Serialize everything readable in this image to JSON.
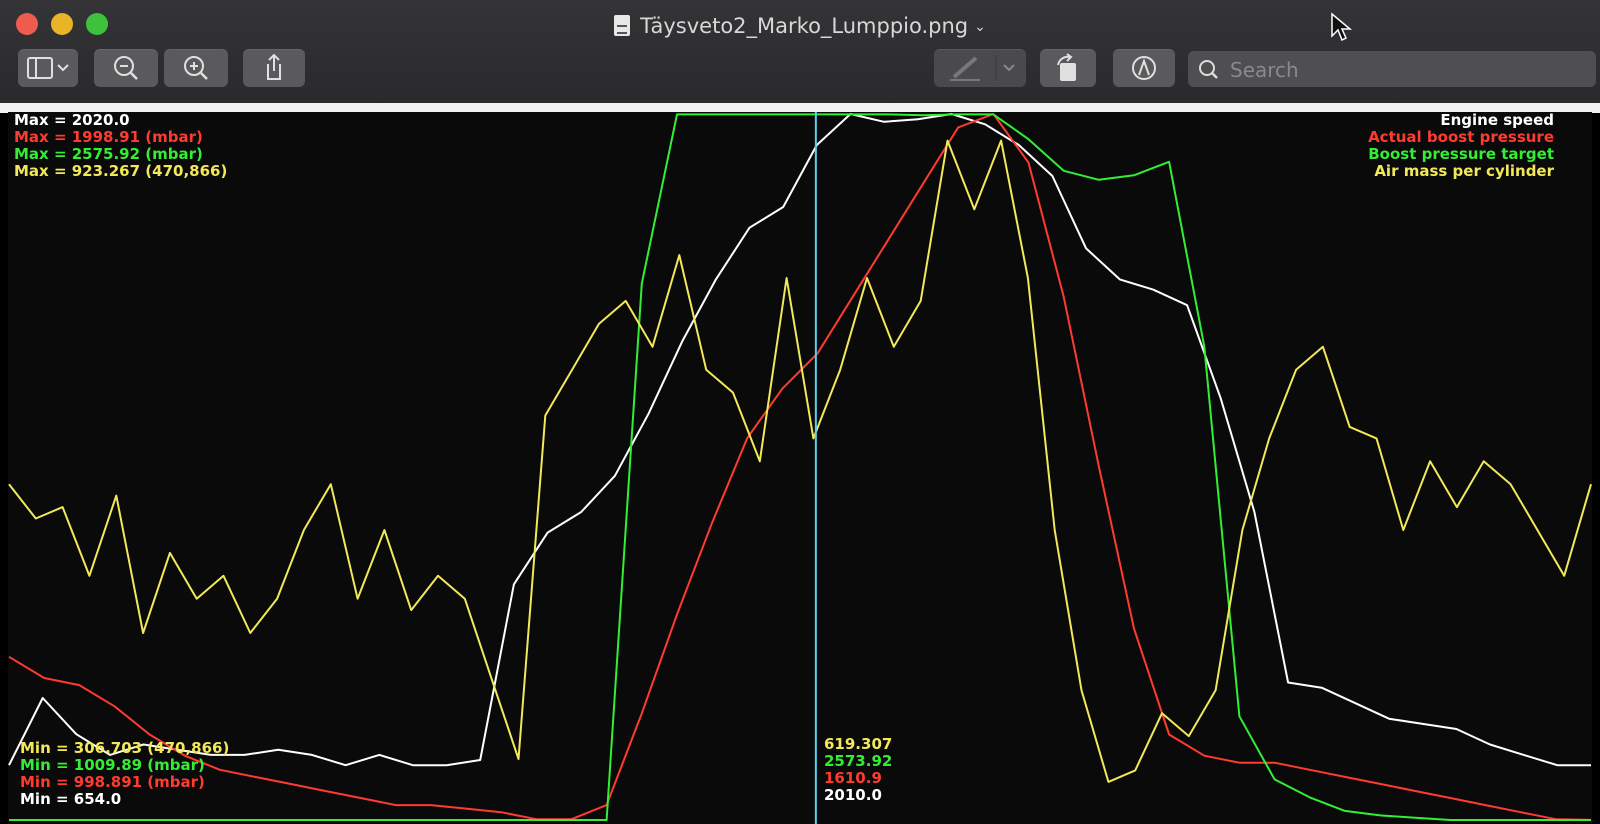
{
  "window": {
    "title": "Täysveto2_Marko_Lumppio.png",
    "search_placeholder": "Search"
  },
  "toolbar": {
    "buttons": [
      "sidebar-toggle",
      "zoom-out",
      "zoom-in",
      "share",
      "markup-pen",
      "rotate",
      "annotate"
    ]
  },
  "colors": {
    "engine_speed": "#ffffff",
    "actual_boost": "#ff3b30",
    "boost_target": "#33ee33",
    "air_mass": "#f2e85a",
    "cursor": "#5ad0f0"
  },
  "legend": {
    "engine_speed": "Engine speed",
    "actual_boost": "Actual boost pressure",
    "boost_target": "Boost pressure target",
    "air_mass": "Air mass per cylinder"
  },
  "max_labels": {
    "engine_speed": "Max = 2020.0",
    "actual_boost": "Max = 1998.91 (mbar)",
    "boost_target": "Max = 2575.92 (mbar)",
    "air_mass": "Max = 923.267 (470,866)"
  },
  "min_labels": {
    "air_mass": "Min = 306.703 (470,866)",
    "boost_target": "Min = 1009.89 (mbar)",
    "actual_boost": "Min = 998.891 (mbar)",
    "engine_speed": "Min = 654.0"
  },
  "cursor_values": {
    "air_mass": "619.307",
    "boost_target": "2573.92",
    "actual_boost": "1610.9",
    "engine_speed": "2010.0"
  },
  "chart_data": {
    "type": "line",
    "x": [
      0,
      2,
      4,
      6,
      8,
      10,
      12,
      14,
      16,
      18,
      20,
      22,
      24,
      26,
      28,
      30,
      32,
      34,
      36,
      37,
      38,
      39,
      40,
      42,
      44,
      46,
      48,
      50,
      51,
      52,
      54,
      56,
      58,
      60,
      62,
      64,
      66,
      68,
      70,
      72,
      74,
      76,
      78,
      80,
      82,
      84,
      86,
      88,
      90,
      92,
      94,
      96,
      98,
      100
    ],
    "cursor_x": 51,
    "series": [
      {
        "key": "engine_speed",
        "name": "Engine speed",
        "min": 654.0,
        "max": 2020.0,
        "values": [
          760,
          890,
          820,
          780,
          800,
          790,
          780,
          780,
          790,
          780,
          760,
          780,
          760,
          760,
          770,
          1110,
          1210,
          1250,
          1320,
          1440,
          1580,
          1700,
          1800,
          1840,
          1960,
          2020,
          2005,
          2010,
          2020,
          2000,
          1960,
          1900,
          1760,
          1700,
          1680,
          1650,
          1470,
          1250,
          920,
          910,
          880,
          850,
          840,
          830,
          800,
          780,
          760,
          760
        ]
      },
      {
        "key": "actual_boost",
        "name": "Actual boost pressure",
        "min": 998.891,
        "max": 1998.91,
        "values": [
          1230,
          1200,
          1190,
          1160,
          1120,
          1090,
          1070,
          1060,
          1050,
          1040,
          1030,
          1020,
          1020,
          1015,
          1010,
          1000,
          1000,
          1020,
          1150,
          1290,
          1420,
          1540,
          1610,
          1660,
          1740,
          1820,
          1900,
          1980,
          2000,
          1930,
          1740,
          1500,
          1270,
          1120,
          1090,
          1080,
          1080,
          1070,
          1060,
          1050,
          1040,
          1030,
          1020,
          1010,
          1000,
          999
        ]
      },
      {
        "key": "boost_target",
        "name": "Boost pressure target",
        "min": 1009.89,
        "max": 2575.92,
        "values": [
          1010,
          1010,
          1010,
          1010,
          1010,
          1010,
          1010,
          1010,
          1010,
          1010,
          1010,
          1010,
          1010,
          1010,
          1010,
          1010,
          1010,
          1010,
          2200,
          2575,
          2575,
          2575,
          2575,
          2575,
          2575,
          2575,
          2573,
          2575,
          2575,
          2520,
          2450,
          2430,
          2440,
          2470,
          2060,
          1240,
          1100,
          1060,
          1030,
          1020,
          1015,
          1010,
          1010,
          1010,
          1010,
          1010
        ]
      },
      {
        "key": "air_mass",
        "name": "Air mass per cylinder",
        "min": 306.703,
        "max": 923.267,
        "values": [
          600,
          570,
          580,
          520,
          590,
          470,
          540,
          500,
          520,
          470,
          500,
          560,
          600,
          500,
          560,
          490,
          520,
          500,
          430,
          360,
          660,
          700,
          740,
          760,
          720,
          800,
          700,
          680,
          620,
          780,
          640,
          700,
          780,
          720,
          760,
          900,
          840,
          900,
          780,
          560,
          420,
          340,
          350,
          400,
          380,
          420,
          560,
          640,
          700,
          720,
          650,
          640,
          560,
          620,
          580,
          620,
          600,
          560,
          520,
          600
        ]
      }
    ]
  }
}
